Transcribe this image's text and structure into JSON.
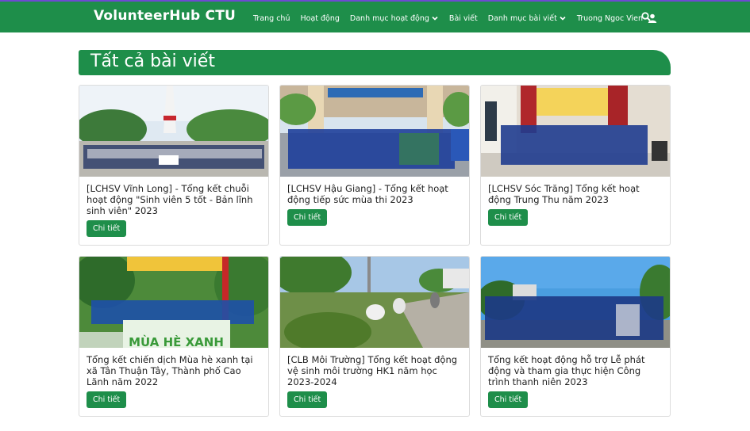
{
  "navbar": {
    "brand": "VolunteerHub CTU",
    "items": [
      "Trang chủ",
      "Hoạt động",
      "Danh mục hoạt động",
      "Bài viết",
      "Danh mục bài viết"
    ],
    "user_name": "Truong Ngoc Vien",
    "icons": [
      "chevron-down-icon",
      "user-icon",
      "search-icon"
    ],
    "color": "#1e8e4a"
  },
  "page": {
    "title": "Tất cả bài viết"
  },
  "cards": [
    {
      "title": "[LCHSV Vĩnh Long] - Tổng kết chuỗi hoạt động \"Sinh viên 5 tốt - Bản lĩnh sinh viên\" 2023",
      "button": "Chi tiết"
    },
    {
      "title": "[LCHSV Hậu Giang] - Tổng kết hoạt động tiếp sức mùa thi 2023",
      "button": "Chi tiết"
    },
    {
      "title": "[LCHSV Sóc Trăng] Tổng kết hoạt động Trung Thu năm 2023",
      "button": "Chi tiết"
    },
    {
      "title": "Tổng kết chiến dịch Mùa hè xanh tại xã Tân Thuận Tây, Thành phố Cao Lãnh năm 2022",
      "button": "Chi tiết"
    },
    {
      "title": "[CLB Môi Trường] Tổng kết hoạt động vệ sinh môi trường HK1 năm học 2023-2024",
      "button": "Chi tiết"
    },
    {
      "title": "Tổng kết hoạt động hỗ trợ Lễ phát động và tham gia thực hiện Công trình thanh niên 2023",
      "button": "Chi tiết"
    }
  ],
  "photo_banner_text": "MÙA HÈ XANH"
}
